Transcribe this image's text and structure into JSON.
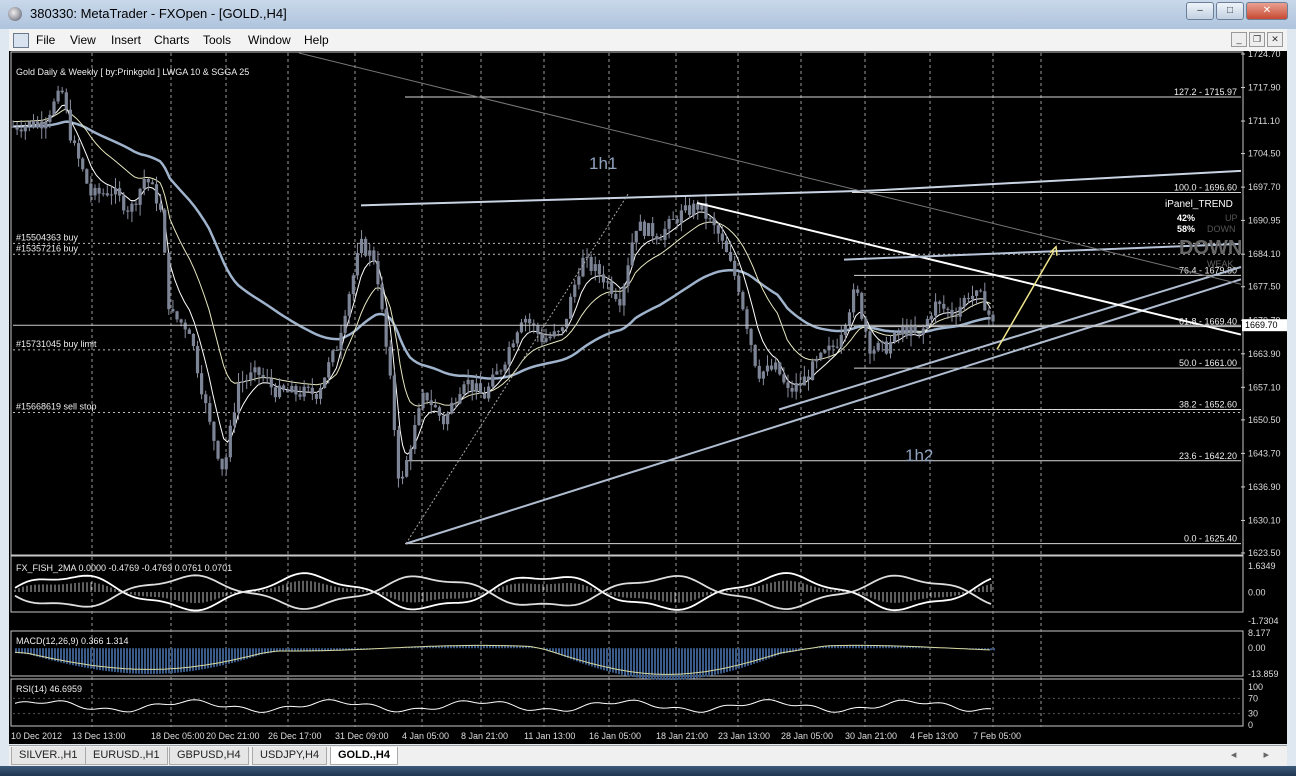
{
  "window": {
    "title": "380330: MetaTrader - FXOpen - [GOLD.,H4]",
    "min": "–",
    "max": "□",
    "close": "✕"
  },
  "menu": {
    "items": [
      "File",
      "View",
      "Insert",
      "Charts",
      "Tools",
      "Window",
      "Help"
    ],
    "mdi": [
      "_",
      "❐",
      "✕"
    ]
  },
  "chart": {
    "indicator_label": "Gold Daily & Weekly [ by:Prinkgold ]  LWGA 10  &  SGGA 25",
    "orders": [
      {
        "label": "#15504363 buy",
        "price": 1687.5
      },
      {
        "label": "#15357216 buy",
        "price": 1685.3
      },
      {
        "label": "#15731045 buy limit",
        "price": 1665.9
      },
      {
        "label": "#15668619 sell stop",
        "price": 1653.2
      }
    ],
    "current_price": "1669.70",
    "fibonacci": [
      {
        "label": "127.2 - 1715.97",
        "price": 1715.97
      },
      {
        "label": "100.0 - 1696.60",
        "price": 1696.6
      },
      {
        "label": "76.4 - 1679.80",
        "price": 1679.8
      },
      {
        "label": "61.8 - 1669.40",
        "price": 1669.4
      },
      {
        "label": "50.0 - 1661.00",
        "price": 1661.0
      },
      {
        "label": "38.2 - 1652.60",
        "price": 1652.6
      },
      {
        "label": "23.6 - 1642.20",
        "price": 1642.2
      },
      {
        "label": "0.0 - 1625.40",
        "price": 1625.4
      }
    ],
    "annotations": [
      "1h1",
      "1h2"
    ],
    "ipanel": {
      "title": "iPanel_TREND",
      "up_pct": "42%",
      "up": "UP",
      "down_pct": "58%",
      "down": "DOWN",
      "big": "DOWN",
      "weak": "WEAK"
    }
  },
  "chart_data": [
    {
      "type": "candlestick",
      "title": "GOLD.,H4",
      "yticks": [
        "1724.70",
        "1717.90",
        "1711.10",
        "1704.50",
        "1697.70",
        "1690.95",
        "1684.10",
        "1677.50",
        "1670.70",
        "1663.90",
        "1657.10",
        "1650.50",
        "1643.70",
        "1636.90",
        "1630.10",
        "1623.50"
      ],
      "ylim": [
        1623.5,
        1724.7
      ],
      "xticks": [
        "10 Dec 2012",
        "13 Dec 13:00",
        "18 Dec 05:00",
        "20 Dec 21:00",
        "26 Dec 17:00",
        "31 Dec 09:00",
        "4 Jan 05:00",
        "8 Jan 21:00",
        "11 Jan 13:00",
        "16 Jan 05:00",
        "18 Jan 21:00",
        "23 Jan 13:00",
        "28 Jan 05:00",
        "30 Jan 21:00",
        "4 Feb 13:00",
        "7 Feb 05:00"
      ],
      "close_path": [
        [
          0,
          1710
        ],
        [
          0.03,
          1711
        ],
        [
          0.05,
          1717
        ],
        [
          0.06,
          1707
        ],
        [
          0.08,
          1696
        ],
        [
          0.1,
          1697
        ],
        [
          0.12,
          1693
        ],
        [
          0.135,
          1700
        ],
        [
          0.15,
          1694
        ],
        [
          0.16,
          1672
        ],
        [
          0.18,
          1669
        ],
        [
          0.2,
          1650
        ],
        [
          0.215,
          1640
        ],
        [
          0.23,
          1658
        ],
        [
          0.25,
          1660
        ],
        [
          0.27,
          1656
        ],
        [
          0.29,
          1656
        ],
        [
          0.31,
          1656
        ],
        [
          0.33,
          1665
        ],
        [
          0.34,
          1674
        ],
        [
          0.355,
          1686
        ],
        [
          0.37,
          1683
        ],
        [
          0.385,
          1658
        ],
        [
          0.395,
          1636
        ],
        [
          0.405,
          1645
        ],
        [
          0.42,
          1656
        ],
        [
          0.44,
          1650
        ],
        [
          0.46,
          1659
        ],
        [
          0.48,
          1655
        ],
        [
          0.5,
          1662
        ],
        [
          0.52,
          1672
        ],
        [
          0.54,
          1667
        ],
        [
          0.56,
          1668
        ],
        [
          0.58,
          1683
        ],
        [
          0.6,
          1680
        ],
        [
          0.62,
          1675
        ],
        [
          0.635,
          1690
        ],
        [
          0.66,
          1688
        ],
        [
          0.68,
          1692
        ],
        [
          0.7,
          1694
        ],
        [
          0.72,
          1688
        ],
        [
          0.74,
          1678
        ],
        [
          0.76,
          1660
        ],
        [
          0.78,
          1661
        ],
        [
          0.79,
          1656
        ],
        [
          0.805,
          1658
        ],
        [
          0.82,
          1662
        ],
        [
          0.84,
          1666
        ],
        [
          0.86,
          1677
        ],
        [
          0.875,
          1665
        ],
        [
          0.89,
          1665
        ],
        [
          0.91,
          1669
        ],
        [
          0.925,
          1667
        ],
        [
          0.94,
          1674
        ],
        [
          0.96,
          1672
        ],
        [
          0.975,
          1676
        ],
        [
          0.99,
          1675
        ],
        [
          1.0,
          1669.7
        ]
      ]
    },
    {
      "type": "line",
      "title": "FX_FISH_2MA 0.0000 -0.4769 -0.4769 0.0761 0.0701",
      "yticks": [
        "1.6349",
        "0.00",
        "-1.7304"
      ],
      "ylim": [
        -1.7304,
        1.6349
      ]
    },
    {
      "type": "bar",
      "title": "MACD(12,26,9) 0.366 1.314",
      "yticks": [
        "8.177",
        "0.00",
        "-13.859"
      ],
      "ylim": [
        -13.859,
        8.177
      ]
    },
    {
      "type": "line",
      "title": "RSI(14) 46.6959",
      "yticks": [
        "100",
        "70",
        "30",
        "0"
      ],
      "ylim": [
        0,
        100
      ]
    }
  ],
  "tabs": [
    "SILVER.,H1",
    "EURUSD.,H1",
    "GBPUSD,H4",
    "USDJPY,H4",
    "GOLD.,H4"
  ],
  "active_tab": "GOLD.,H4",
  "tab_arrows": "◂ ▸"
}
